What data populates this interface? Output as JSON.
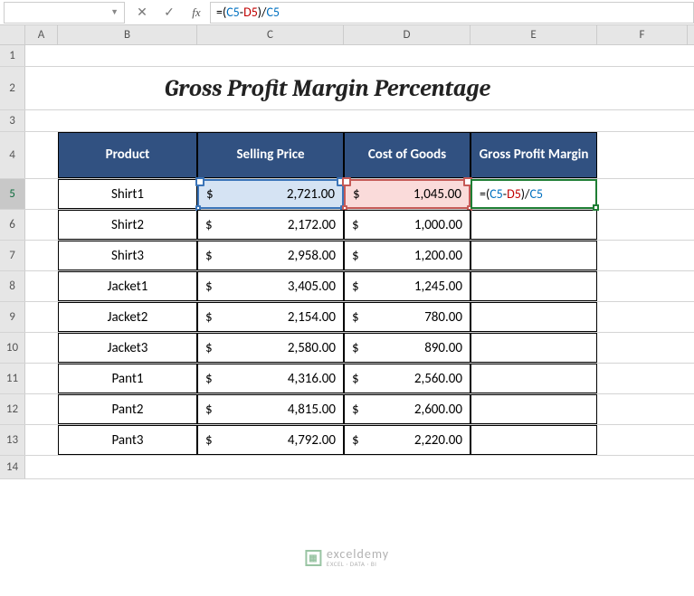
{
  "formula_bar": {
    "name_box": "",
    "cancel_icon": "✕",
    "enter_icon": "✓",
    "fx_label": "fx",
    "formula_text": "=(C5-D5)/C5",
    "parts": {
      "eq": "=(",
      "c5a": "C5",
      "minus": "-",
      "d5": "D5",
      "close": ")/",
      "c5b": "C5"
    }
  },
  "columns": [
    "A",
    "B",
    "C",
    "D",
    "E",
    "F"
  ],
  "rows": [
    "1",
    "2",
    "3",
    "4",
    "5",
    "6",
    "7",
    "8",
    "9",
    "10",
    "11",
    "12",
    "13",
    "14"
  ],
  "active_row": "5",
  "title": "Gross Profit Margin Percentage",
  "headers": {
    "product": "Product",
    "selling": "Selling Price",
    "cost": "Cost of Goods",
    "margin": "Gross Profit Margin"
  },
  "currency": "$",
  "data": [
    {
      "product": "Shirt1",
      "selling": "2,721.00",
      "cost": "1,045.00"
    },
    {
      "product": "Shirt2",
      "selling": "2,172.00",
      "cost": "1,000.00"
    },
    {
      "product": "Shirt3",
      "selling": "2,958.00",
      "cost": "1,200.00"
    },
    {
      "product": "Jacket1",
      "selling": "3,405.00",
      "cost": "1,245.00"
    },
    {
      "product": "Jacket2",
      "selling": "2,154.00",
      "cost": "780.00"
    },
    {
      "product": "Jacket3",
      "selling": "2,580.00",
      "cost": "890.00"
    },
    {
      "product": "Pant1",
      "selling": "4,316.00",
      "cost": "2,560.00"
    },
    {
      "product": "Pant2",
      "selling": "4,815.00",
      "cost": "2,600.00"
    },
    {
      "product": "Pant3",
      "selling": "4,792.00",
      "cost": "2,220.00"
    }
  ],
  "cell_formula": {
    "eq": "=(",
    "c5a": "C5",
    "minus": "-",
    "d5": "D5",
    "close": ")/",
    "c5b": "C5"
  },
  "watermark": {
    "brand": "exceldemy",
    "tag": "EXCEL · DATA · BI"
  }
}
